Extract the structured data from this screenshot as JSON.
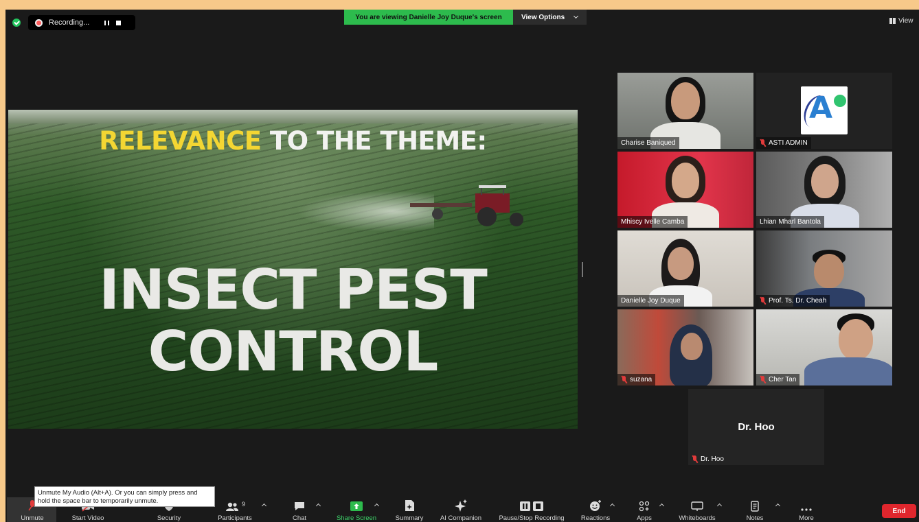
{
  "topbar": {
    "recording_label": "Recording...",
    "viewing_banner": "You are viewing Danielle Joy Duque's screen",
    "view_options": "View Options",
    "view_label": "View"
  },
  "slide": {
    "title_highlight": "RELEVANCE",
    "title_rest": "TO THE THEME:",
    "main_line1": "INSECT PEST",
    "main_line2": "CONTROL",
    "colors": {
      "highlight": "#f3d633",
      "text": "#f2f2f0"
    }
  },
  "participants": [
    {
      "name": "Charise Baniqued",
      "muted": false,
      "active": true
    },
    {
      "name": "ASTI ADMIN",
      "muted": true,
      "active": false
    },
    {
      "name": "Mhiscy Ivelle Camba",
      "muted": false,
      "active": false
    },
    {
      "name": "Lhian Mharl Bantola",
      "muted": false,
      "active": false
    },
    {
      "name": "Danielle Joy Duque",
      "muted": false,
      "active": false
    },
    {
      "name": "Prof. Ts. Dr. Cheah",
      "muted": true,
      "active": false
    },
    {
      "name": "suzana",
      "muted": true,
      "active": false
    },
    {
      "name": "Cher Tan",
      "muted": true,
      "active": false
    }
  ],
  "dr_hoo": {
    "center_name": "Dr. Hoo",
    "bar_name": "Dr. Hoo"
  },
  "tooltip": "Unmute My Audio (Alt+A). Or you can simply press and hold the space bar to temporarily unmute.",
  "toolbar": {
    "unmute": "Unmute",
    "start_video": "Start Video",
    "security": "Security",
    "participants": "Participants",
    "participants_count": "9",
    "chat": "Chat",
    "share_screen": "Share Screen",
    "summary": "Summary",
    "ai_companion": "AI Companion",
    "pause_recording": "Pause/Stop Recording",
    "reactions": "Reactions",
    "apps": "Apps",
    "whiteboards": "Whiteboards",
    "notes": "Notes",
    "more": "More",
    "end": "End"
  },
  "colors": {
    "banner_green": "#2dbb4d",
    "end_red": "#e0262d",
    "active_speaker": "#d6e35a",
    "share_green": "#3ed36a"
  }
}
